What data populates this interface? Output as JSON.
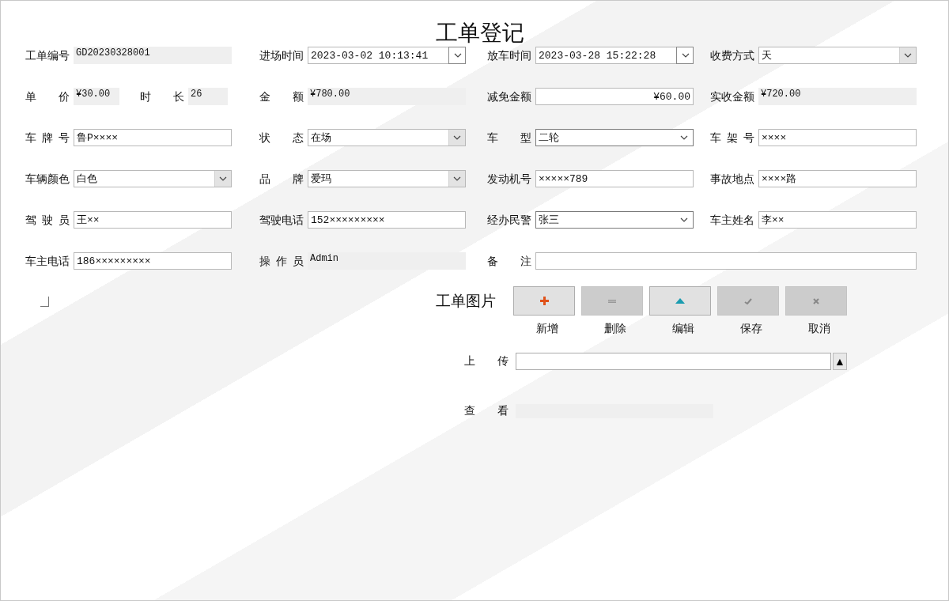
{
  "title": "工单登记",
  "rows": [
    [
      {
        "label": "工单编号",
        "kind": "readonly",
        "value": "GD20230328001"
      },
      {
        "label": "进场时间",
        "kind": "datetime",
        "value": "2023-03-02 10:13:41"
      },
      {
        "label": "放车时间",
        "kind": "datetime",
        "value": "2023-03-28 15:22:28"
      },
      {
        "label": "收费方式",
        "kind": "list",
        "value": "天"
      }
    ],
    [
      {
        "kind": "pair",
        "fields": [
          {
            "label": "单 价",
            "kind": "readonly",
            "value": "¥30.00"
          },
          {
            "label": "时 长",
            "kind": "readonly",
            "value": "26"
          }
        ]
      },
      {
        "label": "金 额",
        "kind": "readonly",
        "value": "¥780.00"
      },
      {
        "label": "减免金额",
        "kind": "number",
        "value": "¥60.00"
      },
      {
        "label": "实收金额",
        "kind": "readonly",
        "value": "¥720.00"
      }
    ],
    [
      {
        "label": "车 牌 号",
        "kind": "text",
        "value": "鲁P××××"
      },
      {
        "label": "状 态",
        "kind": "list",
        "value": "在场"
      },
      {
        "label": "车 型",
        "kind": "combo",
        "value": "二轮"
      },
      {
        "label": "车 架 号",
        "kind": "text",
        "value": "××××"
      }
    ],
    [
      {
        "label": "车辆颜色",
        "kind": "list",
        "value": "白色"
      },
      {
        "label": "品 牌",
        "kind": "list",
        "value": "爱玛"
      },
      {
        "label": "发动机号",
        "kind": "text",
        "value": "×××××789"
      },
      {
        "label": "事故地点",
        "kind": "text",
        "value": "××××路"
      }
    ],
    [
      {
        "label": "驾 驶 员",
        "kind": "text",
        "value": "王××"
      },
      {
        "label": "驾驶电话",
        "kind": "text",
        "value": "152×××××××××"
      },
      {
        "label": "经办民警",
        "kind": "combo",
        "value": "张三"
      },
      {
        "label": "车主姓名",
        "kind": "text",
        "value": "李××"
      }
    ],
    [
      {
        "label": "车主电话",
        "kind": "text",
        "value": "186×××××××××"
      },
      {
        "label": "操 作 员",
        "kind": "readonly",
        "value": "Admin"
      },
      {
        "label": "备 注",
        "kind": "text"
      }
    ]
  ],
  "picture": {
    "title": "工单图片",
    "buttons": [
      {
        "kind": "add",
        "label": "新增",
        "disabled": false
      },
      {
        "kind": "delete",
        "label": "删除",
        "disabled": true
      },
      {
        "kind": "edit",
        "label": "编辑",
        "disabled": false
      },
      {
        "kind": "save",
        "label": "保存",
        "disabled": true
      },
      {
        "kind": "cancel",
        "label": "取消",
        "disabled": true
      }
    ],
    "upload": {
      "label": "上 传",
      "button": "▲"
    },
    "view": {
      "label": "查 看"
    }
  }
}
